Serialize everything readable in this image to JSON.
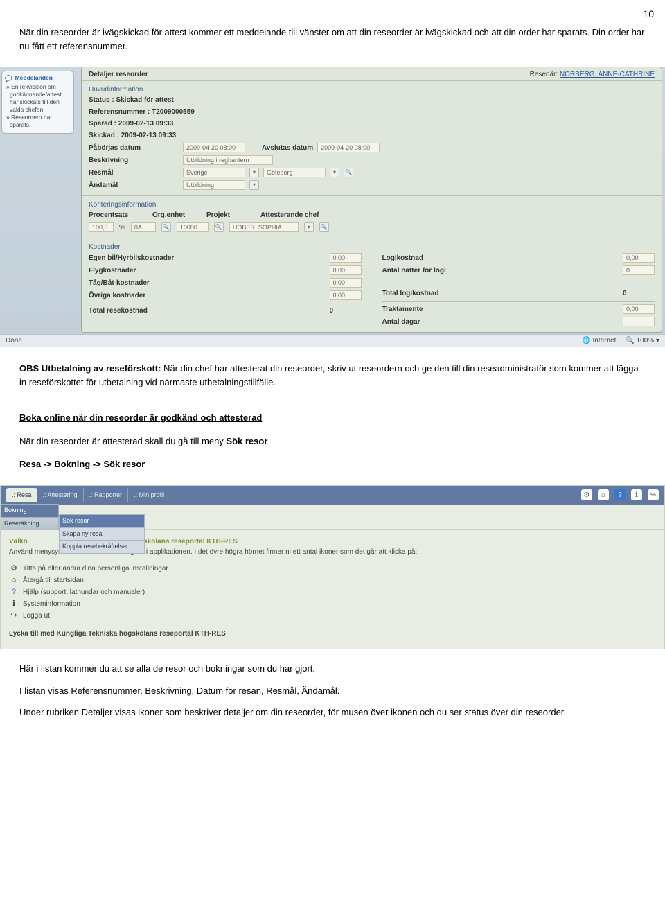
{
  "page_number": "10",
  "intro_paragraph": "När din reseorder är ivägskickad för attest kommer ett meddelande till vänster om att din reseorder är ivägskickad och att din order har sparats. Din order har nu fått ett referensnummer.",
  "screenshot1": {
    "messages_panel": {
      "header": "Meddelanden",
      "items": [
        "En rekvisition om godkännande/attest har skickats till den valda chefen",
        "Reseordern har sparats."
      ]
    },
    "details": {
      "title": "Detaljer reseorder",
      "traveler_label": "Resenär:",
      "traveler_name": "NORBERG, ANNE-CATHRINE",
      "main_section": "Huvudinformation",
      "status_label": "Status :",
      "status_value": "Skickad för attest",
      "ref_label": "Referensnummer :",
      "ref_value": "T2009000559",
      "saved_label": "Sparad :",
      "saved_value": "2009-02-13 09:33",
      "sent_label": "Skickad :",
      "sent_value": "2009-02-13 09:33",
      "start_label": "Påbörjas datum",
      "start_value": "2009-04-20 08:00",
      "end_label": "Avslutas datum",
      "end_value": "2009-04-20 08:00",
      "desc_label": "Beskrivning",
      "desc_value": "Utbildning i reghantern",
      "dest_label": "Resmål",
      "dest_country": "Sverige",
      "dest_city": "Göteborg",
      "purpose_label": "Ändamål",
      "purpose_value": "Utbildning",
      "accounting": {
        "header": "Konteringsinformation",
        "percent_label": "Procentsats",
        "percent_value": "100,0",
        "percent_unit": "%",
        "org_label": "Org.enhet",
        "org_value": "0A",
        "project_label": "Projekt",
        "project_value": "10000",
        "chef_label": "Attesterande chef",
        "chef_value": "HOBER, SOPHIA"
      },
      "costs": {
        "header": "Kostnader",
        "own_car": "Egen bil/Hyrbilskostnader",
        "flight": "Flygkostnader",
        "train": "Tåg/Båt-kostnader",
        "other": "Övriga kostnader",
        "total_travel": "Total resekostnad",
        "total_travel_value": "0",
        "lodging": "Logikostnad",
        "nights": "Antal nätter för logi",
        "total_lodging": "Total logikostnad",
        "total_lodging_value": "0",
        "allowance": "Traktamente",
        "days": "Antal dagar",
        "zero": "0,00",
        "zero2": "0"
      }
    }
  },
  "statusbar": {
    "done": "Done",
    "internet": "Internet",
    "zoom": "100%"
  },
  "obs_label": "OBS Utbetalning av reseförskott:",
  "obs_text": " När din chef har attesterat din reseorder, skriv ut reseordern och ge den till din reseadministratör som kommer att lägga in reseförskottet för utbetalning vid närmaste utbetalningstillfälle.",
  "section2_heading": "Boka online när din reseorder är godkänd och attesterad",
  "section2_line": "När din reseorder är attesterad skall du gå till meny ",
  "section2_strong": "Sök resor",
  "breadcrumb": "Resa -> Bokning -> Sök resor",
  "screenshot2": {
    "tabs": [
      ".: Resa",
      ".: Attestering",
      ".: Rapporter",
      ".: Min profil"
    ],
    "dropdown": {
      "top": "Bokning",
      "second": "Reseräkning"
    },
    "submenu": [
      "Sök resor",
      "Skapa ny resa",
      "Koppla resebekräftelser"
    ],
    "welcome_prefix": "Välko",
    "welcome_title": "niska högskolans reseportal KTH-RES",
    "navline": "Använd menysystemet ovan för att navigera i applikationen. I det övre högra hörnet finner ni ett antal ikoner som det går att klicka på:",
    "items": [
      "Titta på eller ändra dina personliga inställningar",
      "Återgå till startsidan",
      "Hjälp (support, lathundar och manualer)",
      "Systeminformation",
      "Logga ut"
    ],
    "farewell": "Lycka till med Kungliga Tekniska högskolans reseportal KTH-RES"
  },
  "outro1": "Här i listan kommer du att se alla de resor och bokningar som du har gjort.",
  "outro2": "I listan visas Referensnummer, Beskrivning, Datum för resan, Resmål, Ändamål.",
  "outro3": "Under rubriken Detaljer visas ikoner som beskriver detaljer om din reseorder, för musen över ikonen och du ser status över din reseorder."
}
